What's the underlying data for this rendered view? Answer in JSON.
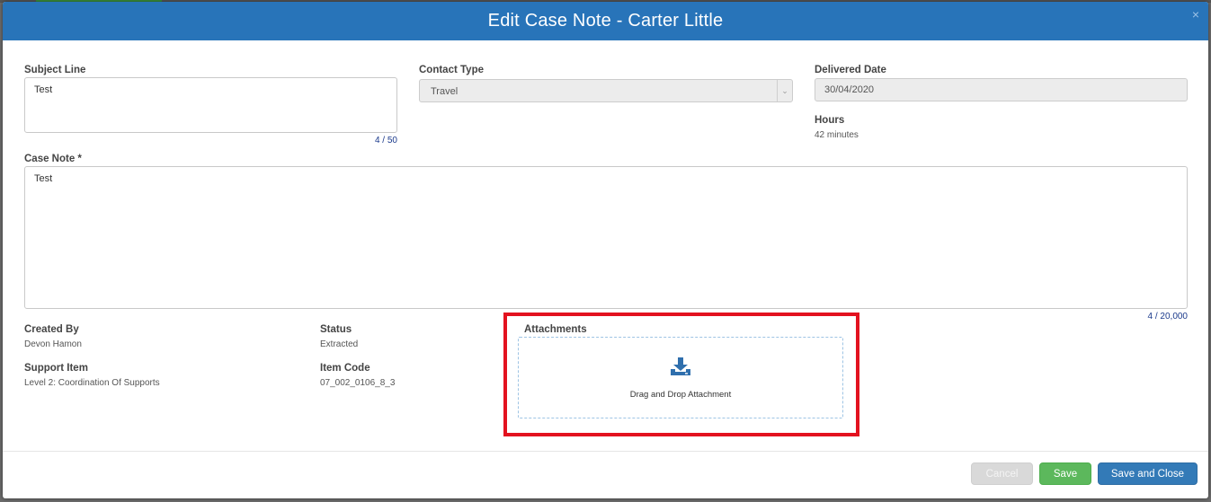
{
  "modal": {
    "title": "Edit Case Note - Carter Little",
    "close_glyph": "×"
  },
  "form": {
    "subject_line": {
      "label": "Subject Line",
      "value": "Test",
      "counter": "4 / 50"
    },
    "contact_type": {
      "label": "Contact Type",
      "selected": "Travel"
    },
    "delivered_date": {
      "label": "Delivered Date",
      "value": "30/04/2020"
    },
    "hours": {
      "label": "Hours",
      "value": "42 minutes"
    },
    "case_note": {
      "label": "Case Note *",
      "value": "Test",
      "counter": "4 / 20,000"
    }
  },
  "details": {
    "created_by": {
      "label": "Created By",
      "value": "Devon Hamon"
    },
    "status": {
      "label": "Status",
      "value": "Extracted"
    },
    "support_item": {
      "label": "Support Item",
      "value": "Level 2: Coordination Of Supports"
    },
    "item_code": {
      "label": "Item Code",
      "value": "07_002_0106_8_3"
    }
  },
  "attachments": {
    "label": "Attachments",
    "dropzone_text": "Drag and Drop Attachment",
    "icon": "download-tray-icon",
    "highlight_color": "#e3121f"
  },
  "footer": {
    "cancel_label": "Cancel",
    "save_label": "Save",
    "save_close_label": "Save and Close"
  },
  "colors": {
    "header": "#2874b9",
    "save": "#5cb85c",
    "save_close": "#337ab7",
    "icon_blue": "#2f6fad"
  }
}
